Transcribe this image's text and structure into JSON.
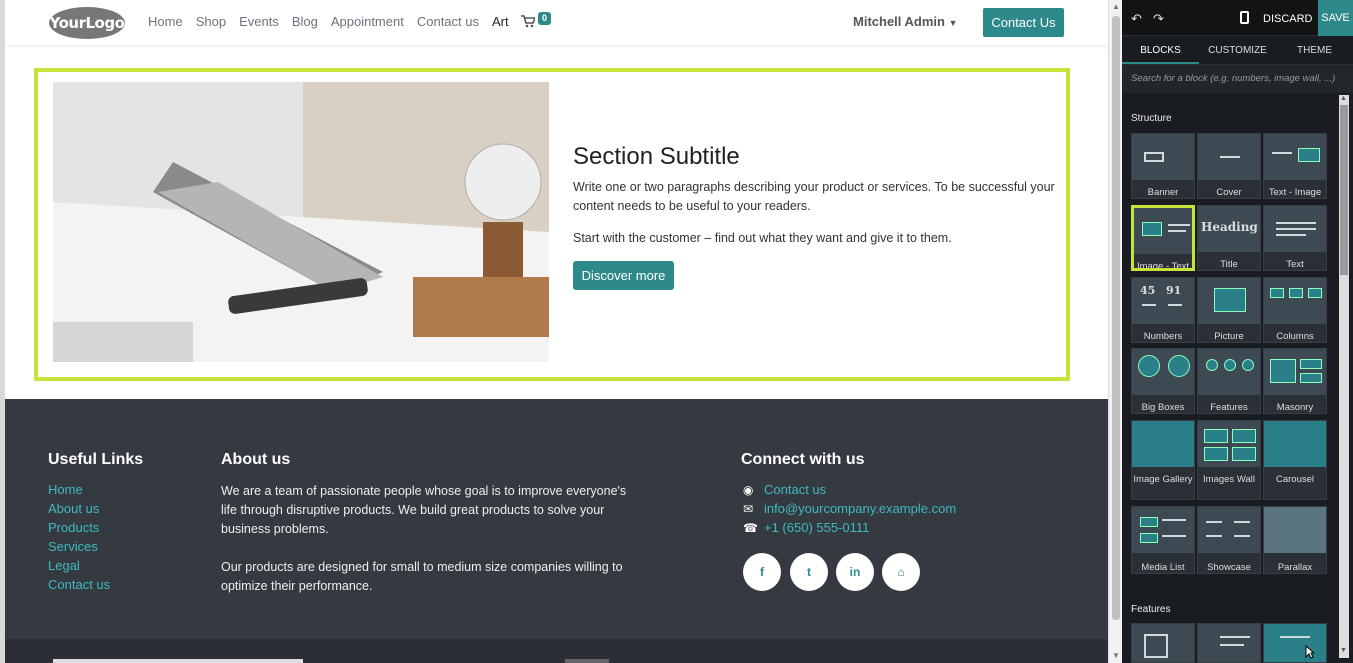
{
  "header": {
    "logo_text": "YourLogo",
    "nav": [
      "Home",
      "Shop",
      "Events",
      "Blog",
      "Appointment",
      "Contact us",
      "Art"
    ],
    "active_nav": "Art",
    "cart_count": "0",
    "user": "Mitchell Admin",
    "cta": "Contact Us"
  },
  "section": {
    "subtitle": "Section Subtitle",
    "para1": "Write one or two paragraphs describing your product or services. To be successful your content needs to be useful to your readers.",
    "para2": "Start with the customer – find out what they want and give it to them.",
    "button": "Discover more"
  },
  "footer": {
    "useful_title": "Useful Links",
    "useful_links": [
      "Home",
      "About us",
      "Products",
      "Services",
      "Legal",
      "Contact us"
    ],
    "about_title": "About us",
    "about_p1": "We are a team of passionate people whose goal is to improve everyone's life through disruptive products. We build great products to solve your business problems.",
    "about_p2": "Our products are designed for small to medium size companies willing to optimize their performance.",
    "connect_title": "Connect with us",
    "contact_us": "Contact us",
    "email": "info@yourcompany.example.com",
    "phone": "+1 (650) 555-0111",
    "social": [
      "f",
      "t",
      "in",
      "home"
    ]
  },
  "panel": {
    "discard": "DISCARD",
    "save": "SAVE",
    "tabs": [
      "BLOCKS",
      "CUSTOMIZE",
      "THEME"
    ],
    "search_placeholder": "Search for a block (e.g. numbers, image wall, ...)",
    "structure_title": "Structure",
    "features_title": "Features",
    "blocks": [
      "Banner",
      "Cover",
      "Text - Image",
      "Image - Text",
      "Title",
      "Text",
      "Numbers",
      "Picture",
      "Columns",
      "Big Boxes",
      "Features",
      "Masonry",
      "Image Gallery",
      "Images Wall",
      "Carousel",
      "Media List",
      "Showcase",
      "Parallax"
    ],
    "selected_block": "Image - Text",
    "heading_thumb": "Heading",
    "numbers_thumb": [
      "45",
      "91"
    ]
  },
  "colors": {
    "accent": "#2e8a8a",
    "highlight": "#c7e33a",
    "footer_bg": "#353a41",
    "panel_bg": "#191c20"
  }
}
